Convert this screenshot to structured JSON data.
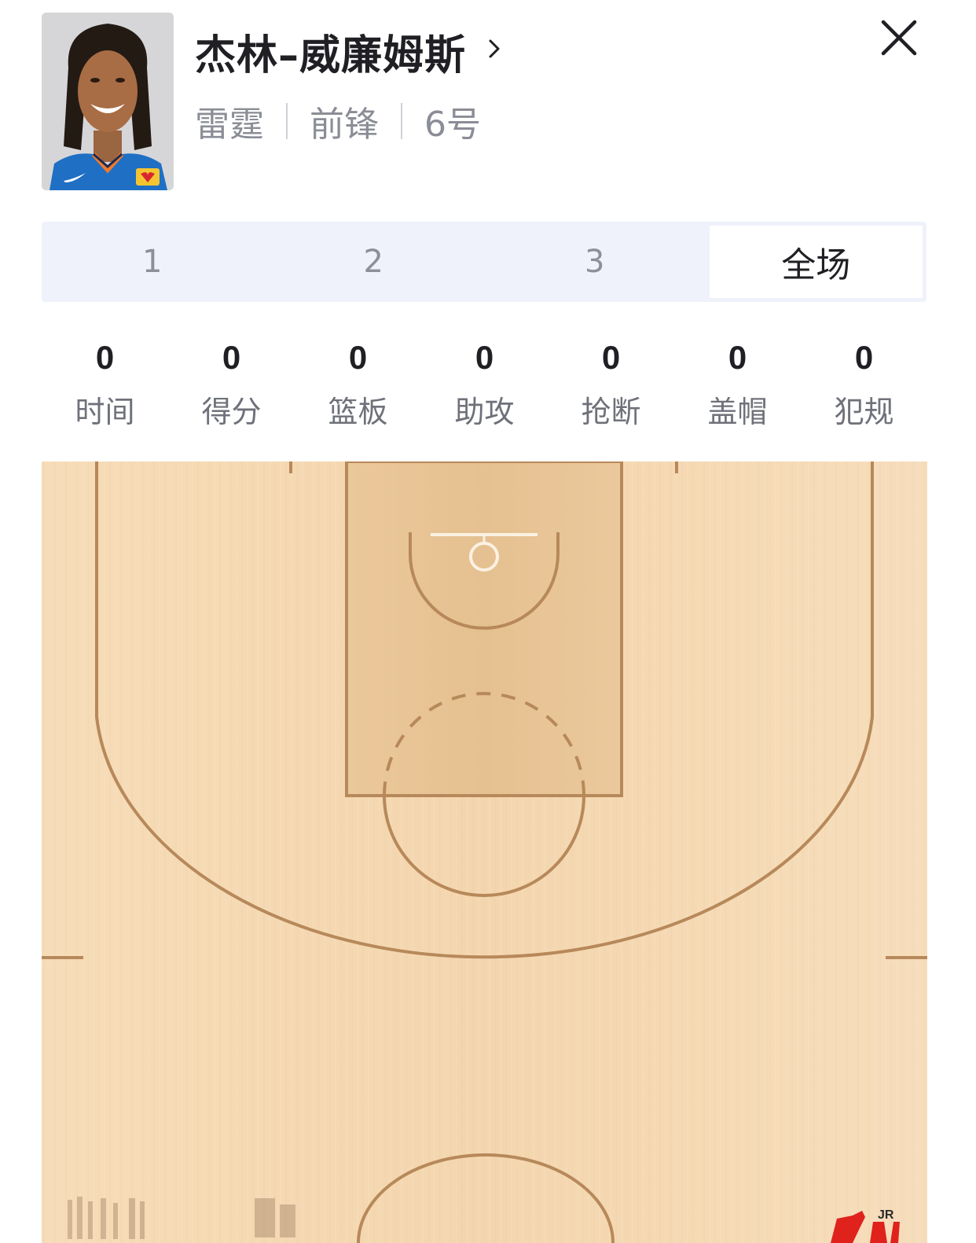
{
  "player": {
    "name": "杰林–威廉姆斯",
    "team": "雷霆",
    "position": "前锋",
    "number": "6号"
  },
  "icons": {
    "close": "close-icon",
    "chevron": "chevron-right-icon",
    "avatar": "player-avatar"
  },
  "tabs": [
    {
      "label": "1",
      "active": false
    },
    {
      "label": "2",
      "active": false
    },
    {
      "label": "3",
      "active": false
    },
    {
      "label": "全场",
      "active": true
    }
  ],
  "stats": [
    {
      "value": "0",
      "label": "时间"
    },
    {
      "value": "0",
      "label": "得分"
    },
    {
      "value": "0",
      "label": "篮板"
    },
    {
      "value": "0",
      "label": "助攻"
    },
    {
      "value": "0",
      "label": "抢断"
    },
    {
      "value": "0",
      "label": "盖帽"
    },
    {
      "value": "0",
      "label": "犯规"
    }
  ],
  "colors": {
    "court_wood": "#f5d9b4",
    "court_line": "#b7895a",
    "paint": "#e9c495",
    "tab_bg": "#eff2fa",
    "watermark_red": "#e0221c"
  }
}
